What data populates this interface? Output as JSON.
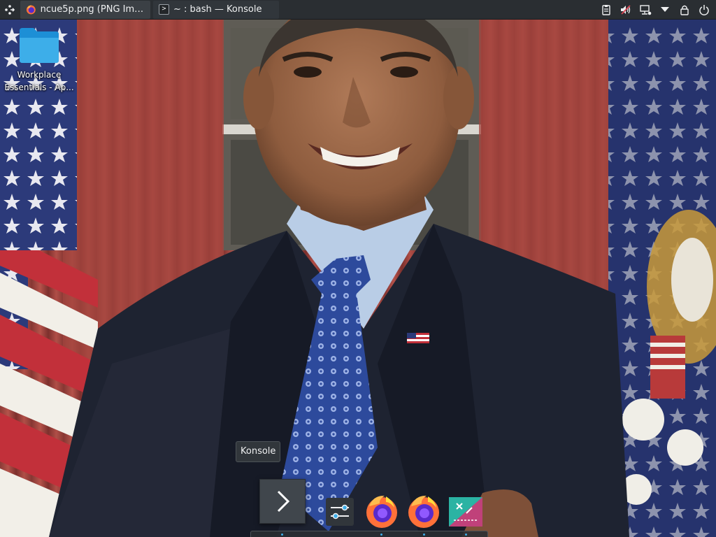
{
  "taskbar": {
    "tasks": [
      {
        "label": "ncue5p.png (PNG Imag...",
        "icon": "firefox-icon",
        "active": true
      },
      {
        "label": "~ : bash — Konsole",
        "icon": "konsole-icon",
        "active": false
      }
    ],
    "tray_icons": [
      "clipboard-icon",
      "volume-muted-icon",
      "network-icon",
      "expand-arrow-icon",
      "lock-icon",
      "power-icon"
    ]
  },
  "desktop": {
    "icons": [
      {
        "label": "Workplace\nEssentials - Ap...",
        "icon": "folder-icon"
      }
    ],
    "wallpaper": "portrait-photo"
  },
  "tooltip": {
    "text": "Konsole"
  },
  "dock": {
    "items": [
      {
        "name": "konsole",
        "icon": "chevron-right-icon"
      },
      {
        "name": "system-settings",
        "icon": "settings-sliders-icon"
      },
      {
        "name": "firefox",
        "icon": "firefox-icon"
      },
      {
        "name": "firefox",
        "icon": "firefox-icon"
      },
      {
        "name": "app",
        "icon": "app-icon"
      }
    ]
  },
  "colors": {
    "panel": "#2a2e32",
    "accent": "#3daee9",
    "text": "#eff0f1"
  }
}
